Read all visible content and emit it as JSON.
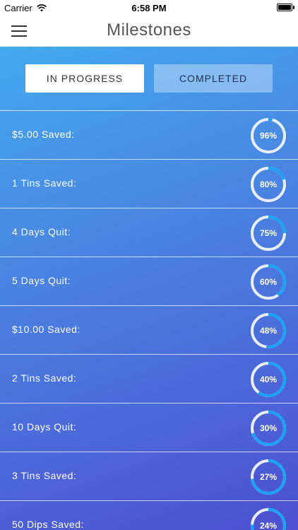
{
  "status": {
    "carrier": "Carrier",
    "time": "6:58 PM"
  },
  "nav": {
    "title": "Milestones"
  },
  "tabs": {
    "in_progress": "IN PROGRESS",
    "completed": "COMPLETED"
  },
  "colors": {
    "ring_track": "#e8eef9",
    "ring_fill": "#1aa3f5"
  },
  "milestones": [
    {
      "label": "$5.00 Saved:",
      "progress": "96%",
      "value": 96
    },
    {
      "label": "1 Tins Saved:",
      "progress": "80%",
      "value": 80
    },
    {
      "label": "4 Days Quit:",
      "progress": "75%",
      "value": 75
    },
    {
      "label": "5 Days Quit:",
      "progress": "60%",
      "value": 60
    },
    {
      "label": "$10.00 Saved:",
      "progress": "48%",
      "value": 48
    },
    {
      "label": "2 Tins Saved:",
      "progress": "40%",
      "value": 40
    },
    {
      "label": "10 Days Quit:",
      "progress": "30%",
      "value": 30
    },
    {
      "label": "3 Tins Saved:",
      "progress": "27%",
      "value": 27
    },
    {
      "label": "50 Dips Saved:",
      "progress": "24%",
      "value": 24
    }
  ]
}
